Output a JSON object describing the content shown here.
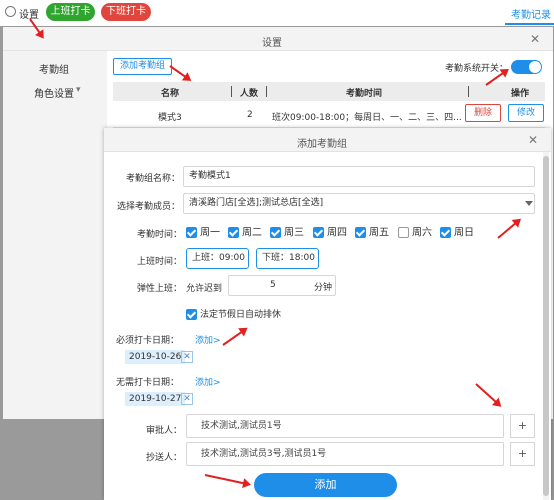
{
  "topbar": {
    "settings_label": "设置",
    "clock_in": "上班打卡",
    "clock_out": "下班打卡",
    "record_tab": "考勤记录"
  },
  "settings_dialog": {
    "title": "设置",
    "close": "✕",
    "nav": [
      {
        "label": "考勤组"
      },
      {
        "label": "角色设置",
        "chevron": "▾"
      }
    ],
    "add_group_button": "添加考勤组",
    "system_switch_label": "考勤系统开关：",
    "table": {
      "headers": [
        "名称",
        "人数",
        "考勤时间",
        "操作"
      ],
      "rows": [
        {
          "name": "模式3",
          "count": "2",
          "time": "班次09:00-18:00；每周日、一、二、三、四...",
          "delete": "删除",
          "edit": "修改"
        }
      ]
    }
  },
  "add_dialog": {
    "title": "添加考勤组",
    "close": "✕",
    "name_label": "考勤组名称：",
    "name_value": "考勤模式1",
    "members_label": "选择考勤成员：",
    "members_value": "清溪路门店[全选];测试总店[全选]",
    "time_label": "考勤时间：",
    "days": [
      {
        "label": "周一",
        "checked": true
      },
      {
        "label": "周二",
        "checked": true
      },
      {
        "label": "周三",
        "checked": true
      },
      {
        "label": "周四",
        "checked": true
      },
      {
        "label": "周五",
        "checked": true
      },
      {
        "label": "周六",
        "checked": false
      },
      {
        "label": "周日",
        "checked": true
      }
    ],
    "work_time_label": "上班时间：",
    "start_time": "上班：09:00",
    "end_time": "下班：18:00",
    "flex_label": "弹性上班：",
    "allow_late": "允许迟到",
    "late_value": "5",
    "late_unit": "分钟",
    "holiday_label": "法定节假日自动排休",
    "required_label": "必须打卡日期：",
    "required_add": "添加>",
    "required_date": "2019-10-26",
    "exempt_label": "无需打卡日期：",
    "exempt_add": "添加>",
    "exempt_date": "2019-10-27",
    "approver_label": "审批人：",
    "approver_value": "技术测试,测试员1号",
    "cc_label": "抄送人：",
    "cc_value": "技术测试,测试员3号,测试员1号",
    "plus": "+",
    "submit": "添加",
    "tag_close": "✕"
  },
  "colors": {
    "accent": "#1f8ee8",
    "green": "#2fa52f",
    "red": "#e0463e",
    "arrow": "#e32020"
  }
}
